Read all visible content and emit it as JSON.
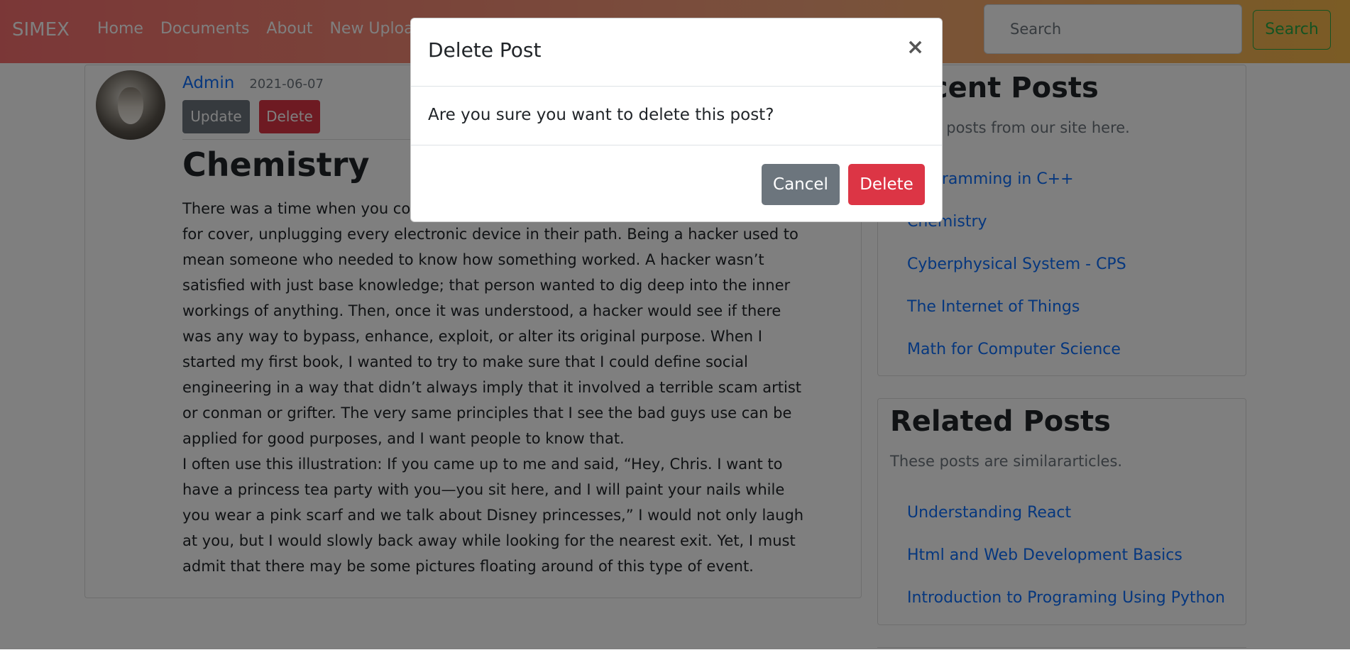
{
  "navbar": {
    "brand": "SIMEX",
    "links": [
      "Home",
      "Documents",
      "About",
      "New Upload"
    ],
    "search_placeholder": "Search",
    "search_button": "Search"
  },
  "post": {
    "author": "Admin",
    "date": "2021-06-07",
    "update_label": "Update",
    "delete_label": "Delete",
    "title": "Chemistry",
    "paragraphs": [
      "There was a time when you could yell “hacker” in a room and cause people to run for cover, unplugging every electronic device in their path. Being a hacker used to mean someone who needed to know how something worked. A hacker wasn’t satisfied with just base knowledge; that person wanted to dig deep into the inner workings of anything. Then, once it was understood, a hacker would see if there was any way to bypass, enhance, exploit, or alter its original purpose. When I started my first book, I wanted to try to make sure that I could define social engineering in a way that didn’t always imply that it involved a terrible scam artist or conman or grifter. The very same principles that I see the bad guys use can be applied for good purposes, and I want people to know that.",
      "I often use this illustration: If you came up to me and said, “Hey, Chris. I want to have a princess tea party with you—you sit here, and I will paint your nails while you wear a pink scarf and we talk about Disney princesses,” I would not only laugh at you, but I would slowly back away while looking for the nearest exit. Yet, I must admit that there may be some pictures floating around of this type of event."
    ]
  },
  "sidebar": {
    "recent": {
      "title": "Recent Posts",
      "description": "Recent posts from our site here.",
      "items": [
        "Programming in C++",
        "Chemistry",
        "Cyberphysical System - CPS",
        "The Internet of Things",
        "Math for Computer Science"
      ]
    },
    "related": {
      "title": "Related Posts",
      "description": "These posts are similararticles.",
      "items": [
        "Understanding React",
        "Html and Web Development Basics",
        "Introduction to Programing Using Python"
      ]
    }
  },
  "modal": {
    "title": "Delete Post",
    "close_glyph": "×",
    "message": "Are you sure you want to delete this post?",
    "cancel_label": "Cancel",
    "delete_label": "Delete"
  },
  "colors": {
    "primary": "#0d6efd",
    "danger": "#dc3545",
    "secondary": "#6c757d",
    "success": "#28a745"
  }
}
